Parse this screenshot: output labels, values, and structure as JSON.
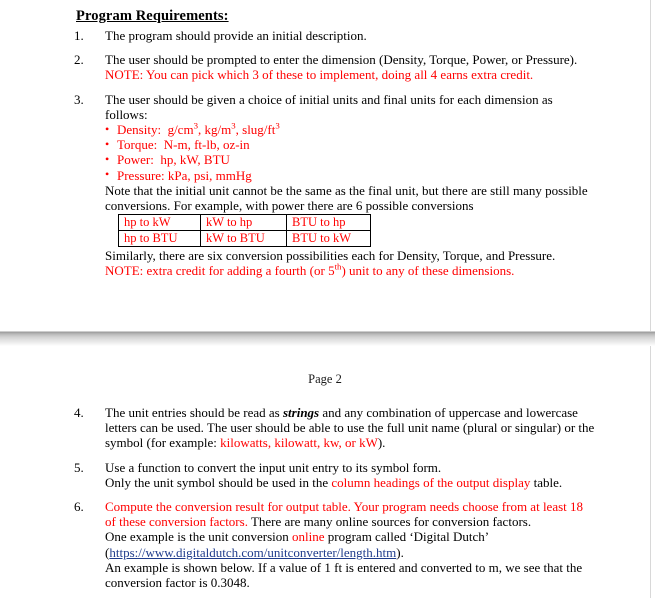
{
  "document": {
    "heading": "Program Requirements:",
    "page_label": "Page 2",
    "colors": {
      "emphasis_red": "#ff0000",
      "hyperlink_blue": "#1f3c8c",
      "text_black": "#000000"
    }
  },
  "items": [
    {
      "number": "1.",
      "line1": "The program should provide an initial description."
    },
    {
      "number": "2.",
      "line1": "The user should be prompted to enter the dimension (Density, Torque, Power, or Pressure).",
      "note_red": "NOTE:  You can pick which 3 of these to implement, doing all 4 earns extra credit."
    },
    {
      "number": "3.",
      "line1": "The user should be given a choice of initial units and final units for each dimension as",
      "line2": "follows:",
      "bullets": [
        {
          "label": "Density:",
          "units_pre": "g/cm",
          "sup1": "3",
          "units_mid": ", kg/m",
          "sup2": "3",
          "units_post": ", slug/ft",
          "sup3": "3"
        },
        {
          "label": "Torque:",
          "units": "N-m, ft-lb, oz-in"
        },
        {
          "label": "Power:",
          "units": "hp, kW, BTU"
        },
        {
          "label": "Pressure:",
          "units": "kPa, psi, mmHg"
        }
      ],
      "note_line1": "Note that the initial unit cannot be the same as the final unit, but there are still many possible",
      "note_line2": "conversions.  For example, with power there are 6 possible conversions",
      "table": {
        "rows": [
          [
            "hp to kW",
            "kW to hp",
            "BTU to hp"
          ],
          [
            "hp to BTU",
            "kW to BTU",
            "BTU to kW"
          ]
        ]
      },
      "after_table_line": "Similarly, there are six conversion possibilities each for Density, Torque, and Pressure.",
      "after_table_note_pre": "NOTE: extra credit for adding a fourth (or 5",
      "after_table_note_sup": "th",
      "after_table_note_post": ") unit to any of these dimensions."
    },
    {
      "number": "4.",
      "line1_a": "The unit entries should be read as ",
      "line1_bold": "strings",
      "line1_b": " and any combination of uppercase and lowercase",
      "line2": "letters can be used.  The user should be able to use the full unit name (plural or singular) or the",
      "line3_a": "symbol (for example: ",
      "line3_red": "kilowatts, kilowatt, kw, or kW",
      "line3_b": ")."
    },
    {
      "number": "5.",
      "line1": "Use a function to convert the input unit entry to its symbol form.",
      "line2_a": "Only the unit symbol should be used in the ",
      "line2_red": "column headings of the output display",
      "line2_b": " table."
    },
    {
      "number": "6.",
      "line1_red": "Compute the conversion result for output table.  Your program needs choose from at least 18",
      "line2_red": "of these conversion factors.",
      "line2_b": "  There are many online sources for conversion factors.",
      "line3_a": "One example is the unit conversion ",
      "line3_red": "online",
      "line3_b": " program called ‘Digital Dutch’",
      "line4_a": "(",
      "line4_link": "https://www.digitaldutch.com/unitconverter/length.htm",
      "line4_b": ").",
      "line5": "An example is shown below.  If a value of 1 ft is entered and converted to m, we see that the",
      "line6": "conversion factor is 0.3048."
    }
  ]
}
